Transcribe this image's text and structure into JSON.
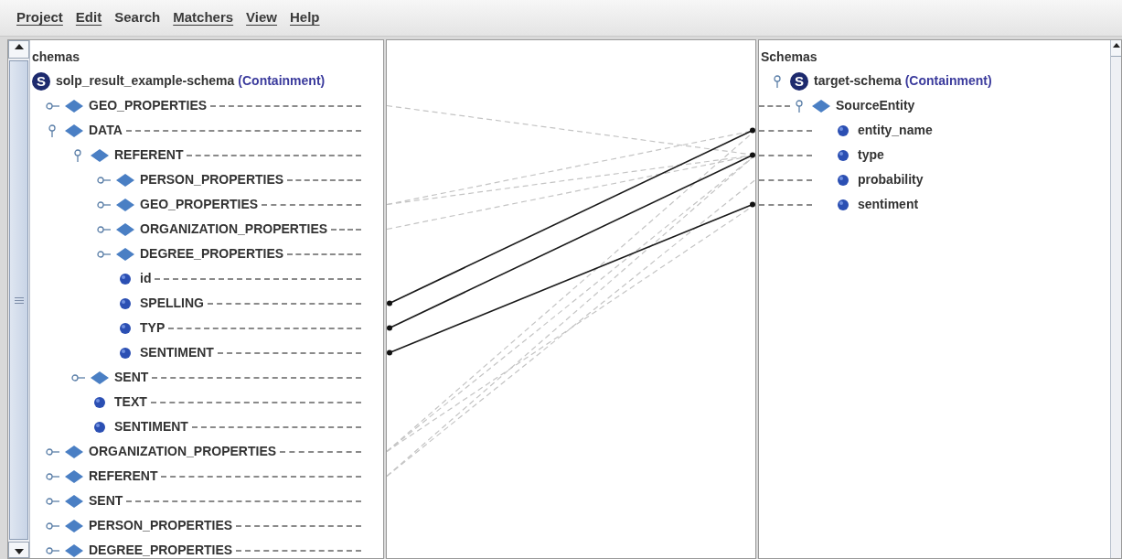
{
  "menu": [
    {
      "label": "Project",
      "mnemonic": true
    },
    {
      "label": "Edit",
      "mnemonic": true
    },
    {
      "label": "Search",
      "mnemonic": false
    },
    {
      "label": "Matchers",
      "mnemonic": true
    },
    {
      "label": "View",
      "mnemonic": true
    },
    {
      "label": "Help",
      "mnemonic": true
    }
  ],
  "source_panel": {
    "header": "chemas",
    "root": {
      "kind": "schema",
      "badge": "S",
      "label": "solp_result_example-schema",
      "qualifier": "(Containment)",
      "children": [
        {
          "kind": "entity",
          "label": "GEO_PROPERTIES",
          "expanded": false
        },
        {
          "kind": "entity",
          "label": "DATA",
          "expanded": true,
          "children": [
            {
              "kind": "entity",
              "label": "REFERENT",
              "expanded": true,
              "children": [
                {
                  "kind": "entity",
                  "label": "PERSON_PROPERTIES",
                  "expanded": false
                },
                {
                  "kind": "entity",
                  "label": "GEO_PROPERTIES",
                  "expanded": false
                },
                {
                  "kind": "entity",
                  "label": "ORGANIZATION_PROPERTIES",
                  "expanded": false
                },
                {
                  "kind": "entity",
                  "label": "DEGREE_PROPERTIES",
                  "expanded": false
                },
                {
                  "kind": "attribute",
                  "label": "id"
                },
                {
                  "kind": "attribute",
                  "label": "SPELLING"
                },
                {
                  "kind": "attribute",
                  "label": "TYP"
                },
                {
                  "kind": "attribute",
                  "label": "SENTIMENT"
                }
              ]
            },
            {
              "kind": "entity",
              "label": "SENT",
              "expanded": false
            },
            {
              "kind": "attribute",
              "label": "TEXT"
            },
            {
              "kind": "attribute",
              "label": "SENTIMENT"
            }
          ]
        },
        {
          "kind": "entity",
          "label": "ORGANIZATION_PROPERTIES",
          "expanded": false
        },
        {
          "kind": "entity",
          "label": "REFERENT",
          "expanded": false
        },
        {
          "kind": "entity",
          "label": "SENT",
          "expanded": false
        },
        {
          "kind": "entity",
          "label": "PERSON_PROPERTIES",
          "expanded": false
        },
        {
          "kind": "entity",
          "label": "DEGREE_PROPERTIES",
          "expanded": false
        }
      ]
    }
  },
  "target_panel": {
    "header": "Schemas",
    "root": {
      "kind": "schema",
      "badge": "S",
      "label": "target-schema",
      "qualifier": "(Containment)",
      "expanded": true,
      "children": [
        {
          "kind": "entity",
          "label": "SourceEntity",
          "expanded": true,
          "children": [
            {
              "kind": "attribute",
              "label": "entity_name"
            },
            {
              "kind": "attribute",
              "label": "type"
            },
            {
              "kind": "attribute",
              "label": "probability"
            },
            {
              "kind": "attribute",
              "label": "sentiment"
            }
          ]
        }
      ]
    }
  }
}
